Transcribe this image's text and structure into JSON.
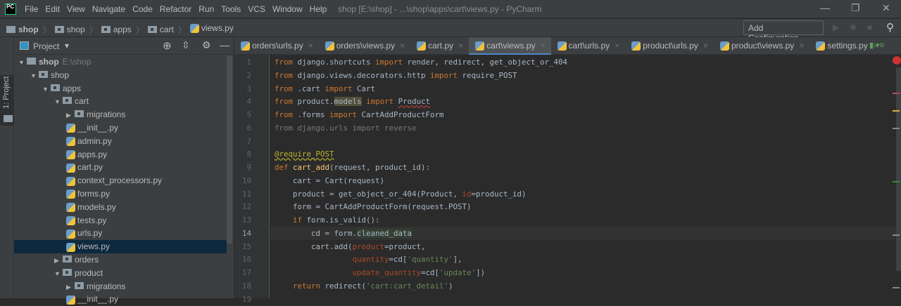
{
  "titlebar": {
    "logo": "PC",
    "menu": [
      "File",
      "Edit",
      "View",
      "Navigate",
      "Code",
      "Refactor",
      "Run",
      "Tools",
      "VCS",
      "Window",
      "Help"
    ],
    "title": "shop [E:\\shop] - ...\\shop\\apps\\cart\\views.py - PyCharm",
    "minimize": "—",
    "restore": "❐",
    "close": "✕"
  },
  "breadcrumb": [
    "shop",
    "shop",
    "apps",
    "cart",
    "views.py"
  ],
  "toolbar": {
    "add_configuration": "Add Configuration...",
    "run": "▶",
    "debug": "✱",
    "stop": "■",
    "search": "⚲"
  },
  "tool_window": {
    "side_tab": "1: Project",
    "title": "Project",
    "dropdown": "▾"
  },
  "tree": [
    {
      "label": "shop",
      "hint": "E:\\shop",
      "depth": 0,
      "type": "folder",
      "expanded": true,
      "bold": true
    },
    {
      "label": "shop",
      "depth": 1,
      "type": "folder",
      "expanded": true
    },
    {
      "label": "apps",
      "depth": 2,
      "type": "folder",
      "expanded": true
    },
    {
      "label": "cart",
      "depth": 3,
      "type": "folder",
      "expanded": true
    },
    {
      "label": "migrations",
      "depth": 4,
      "type": "folder",
      "expanded": false
    },
    {
      "label": "__init__.py",
      "depth": 4,
      "type": "py"
    },
    {
      "label": "admin.py",
      "depth": 4,
      "type": "py"
    },
    {
      "label": "apps.py",
      "depth": 4,
      "type": "py"
    },
    {
      "label": "cart.py",
      "depth": 4,
      "type": "py"
    },
    {
      "label": "context_processors.py",
      "depth": 4,
      "type": "py"
    },
    {
      "label": "forms.py",
      "depth": 4,
      "type": "py"
    },
    {
      "label": "models.py",
      "depth": 4,
      "type": "py"
    },
    {
      "label": "tests.py",
      "depth": 4,
      "type": "py"
    },
    {
      "label": "urls.py",
      "depth": 4,
      "type": "py"
    },
    {
      "label": "views.py",
      "depth": 4,
      "type": "py",
      "selected": true
    },
    {
      "label": "orders",
      "depth": 3,
      "type": "folder",
      "expanded": false
    },
    {
      "label": "product",
      "depth": 3,
      "type": "folder",
      "expanded": true
    },
    {
      "label": "migrations",
      "depth": 4,
      "type": "folder",
      "expanded": false
    },
    {
      "label": "__init__.py",
      "depth": 4,
      "type": "py"
    }
  ],
  "tabs": [
    {
      "label": "orders\\urls.py"
    },
    {
      "label": "orders\\views.py"
    },
    {
      "label": "cart.py"
    },
    {
      "label": "cart\\views.py",
      "active": true
    },
    {
      "label": "cart\\urls.py"
    },
    {
      "label": "product\\urls.py"
    },
    {
      "label": "product\\views.py"
    },
    {
      "label": "settings.py"
    }
  ],
  "editor": {
    "current_line": 14,
    "lines": [
      [
        [
          "from",
          "k"
        ],
        " django.shortcuts ",
        [
          "import",
          "k"
        ],
        " render, redirect, get_object_or_404"
      ],
      [
        [
          "from",
          "k"
        ],
        " django.views.decorators.http ",
        [
          "import",
          "k"
        ],
        " require_POST"
      ],
      [
        [
          "from",
          "k"
        ],
        " .cart ",
        [
          "import",
          "k"
        ],
        " Cart"
      ],
      [
        [
          "from",
          "k"
        ],
        " product.",
        [
          "models",
          "h"
        ],
        " ",
        [
          "import",
          "k"
        ],
        " ",
        [
          "Product",
          "w"
        ]
      ],
      [
        [
          "from",
          "k"
        ],
        " .forms ",
        [
          "import",
          "k"
        ],
        " CartAddProductForm"
      ],
      [
        [
          "from django.urls import reverse",
          "u"
        ]
      ],
      [
        ""
      ],
      [
        [
          "@require_POST",
          "d"
        ]
      ],
      [
        [
          "def",
          "k"
        ],
        " ",
        [
          "cart_add",
          "f"
        ],
        "(request, product_id):"
      ],
      [
        "    cart = Cart(request)"
      ],
      [
        "    product = get_object_or_404(Product, ",
        [
          "id",
          "p"
        ],
        "=product_id)"
      ],
      [
        "    form = CartAddProductForm(request.POST)"
      ],
      [
        "    ",
        [
          "if",
          "k"
        ],
        " form.is_valid():"
      ],
      [
        "        cd = form.",
        [
          "cleaned_data",
          "g"
        ]
      ],
      [
        "        cart.add(",
        [
          "product",
          "p"
        ],
        "=product,"
      ],
      [
        "                 ",
        [
          "quantity",
          "p"
        ],
        "=cd[",
        [
          "'quantity'",
          "s"
        ],
        "],"
      ],
      [
        "                 ",
        [
          "update_quantity",
          "p"
        ],
        "=cd[",
        [
          "'update'",
          "s"
        ],
        "])"
      ],
      [
        "    ",
        [
          "return",
          "k"
        ],
        " redirect(",
        [
          "'cart:cart_detail'",
          "s"
        ],
        ")"
      ],
      [
        ""
      ]
    ]
  },
  "colors": {
    "accent": "#4a88c7",
    "keyword": "#cc7832",
    "string": "#6a8759",
    "param": "#aa4926",
    "decorator": "#bbb529",
    "selection": "#0d293e"
  }
}
